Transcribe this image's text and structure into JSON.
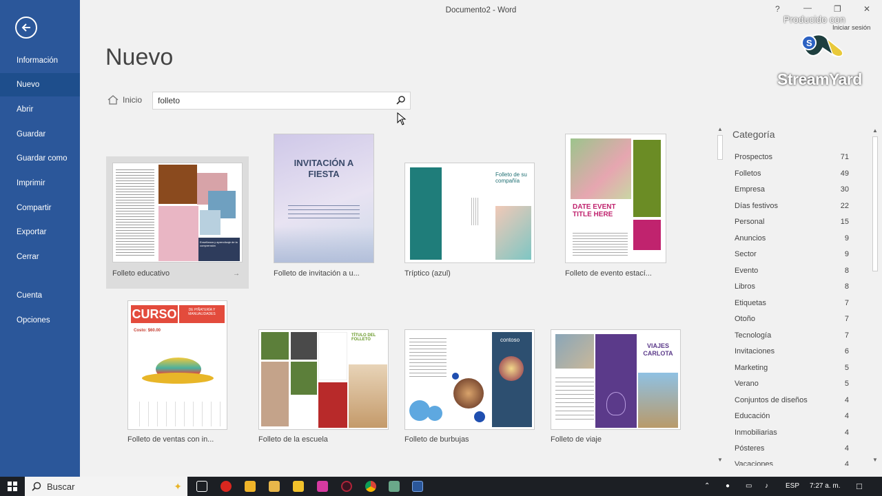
{
  "window": {
    "title": "Documento2 - Word",
    "help": "?",
    "sign_in": "Iniciar sesión"
  },
  "sidebar": {
    "items": [
      {
        "label": "Información"
      },
      {
        "label": "Nuevo"
      },
      {
        "label": "Abrir"
      },
      {
        "label": "Guardar"
      },
      {
        "label": "Guardar como"
      },
      {
        "label": "Imprimir"
      },
      {
        "label": "Compartir"
      },
      {
        "label": "Exportar"
      },
      {
        "label": "Cerrar"
      },
      {
        "label": "Cuenta"
      },
      {
        "label": "Opciones"
      }
    ]
  },
  "main": {
    "title": "Nuevo",
    "home_label": "Inicio",
    "search_value": "folleto"
  },
  "templates": [
    {
      "label": "Folleto educativo",
      "inner": "Enseñanza y aprendizaje de la comprensión"
    },
    {
      "label": "Folleto de invitación a u...",
      "inner": "INVITACIÓN A FIESTA"
    },
    {
      "label": "Tríptico (azul)",
      "inner": "Folleto de su compañía"
    },
    {
      "label": "Folleto de evento estací...",
      "inner": "DATE EVENT TITLE HERE"
    },
    {
      "label": "Folleto de ventas con in...",
      "inner": "CURSO",
      "inner2": "DE PIÑATERÍA Y MANUALIDADES",
      "inner3": "Costo: $60.00"
    },
    {
      "label": "Folleto de la escuela",
      "inner": "TÍTULO DEL FOLLETO"
    },
    {
      "label": "Folleto de burbujas",
      "inner": "contoso"
    },
    {
      "label": "Folleto de viaje",
      "inner": "VIAJES CARLOTA"
    }
  ],
  "categories": {
    "title": "Categoría",
    "items": [
      {
        "name": "Prospectos",
        "count": "71"
      },
      {
        "name": "Folletos",
        "count": "49"
      },
      {
        "name": "Empresa",
        "count": "30"
      },
      {
        "name": "Días festivos",
        "count": "22"
      },
      {
        "name": "Personal",
        "count": "15"
      },
      {
        "name": "Anuncios",
        "count": "9"
      },
      {
        "name": "Sector",
        "count": "9"
      },
      {
        "name": "Evento",
        "count": "8"
      },
      {
        "name": "Libros",
        "count": "8"
      },
      {
        "name": "Etiquetas",
        "count": "7"
      },
      {
        "name": "Otoño",
        "count": "7"
      },
      {
        "name": "Tecnología",
        "count": "7"
      },
      {
        "name": "Invitaciones",
        "count": "6"
      },
      {
        "name": "Marketing",
        "count": "5"
      },
      {
        "name": "Verano",
        "count": "5"
      },
      {
        "name": "Conjuntos de diseños",
        "count": "4"
      },
      {
        "name": "Educación",
        "count": "4"
      },
      {
        "name": "Inmobiliarias",
        "count": "4"
      },
      {
        "name": "Pósteres",
        "count": "4"
      },
      {
        "name": "Vacaciones",
        "count": "4"
      }
    ]
  },
  "watermark": {
    "produced_by": "Producido con",
    "brand": "StreamYard"
  },
  "taskbar": {
    "search_label": "Buscar",
    "language": "ESP",
    "time": "7:27 a. m."
  },
  "colors": {
    "accent": "#2b579a",
    "sidebar_active": "#1e4e8c"
  },
  "icons": [
    "back-arrow-icon",
    "home-icon",
    "search-icon",
    "windows-start-icon"
  ]
}
